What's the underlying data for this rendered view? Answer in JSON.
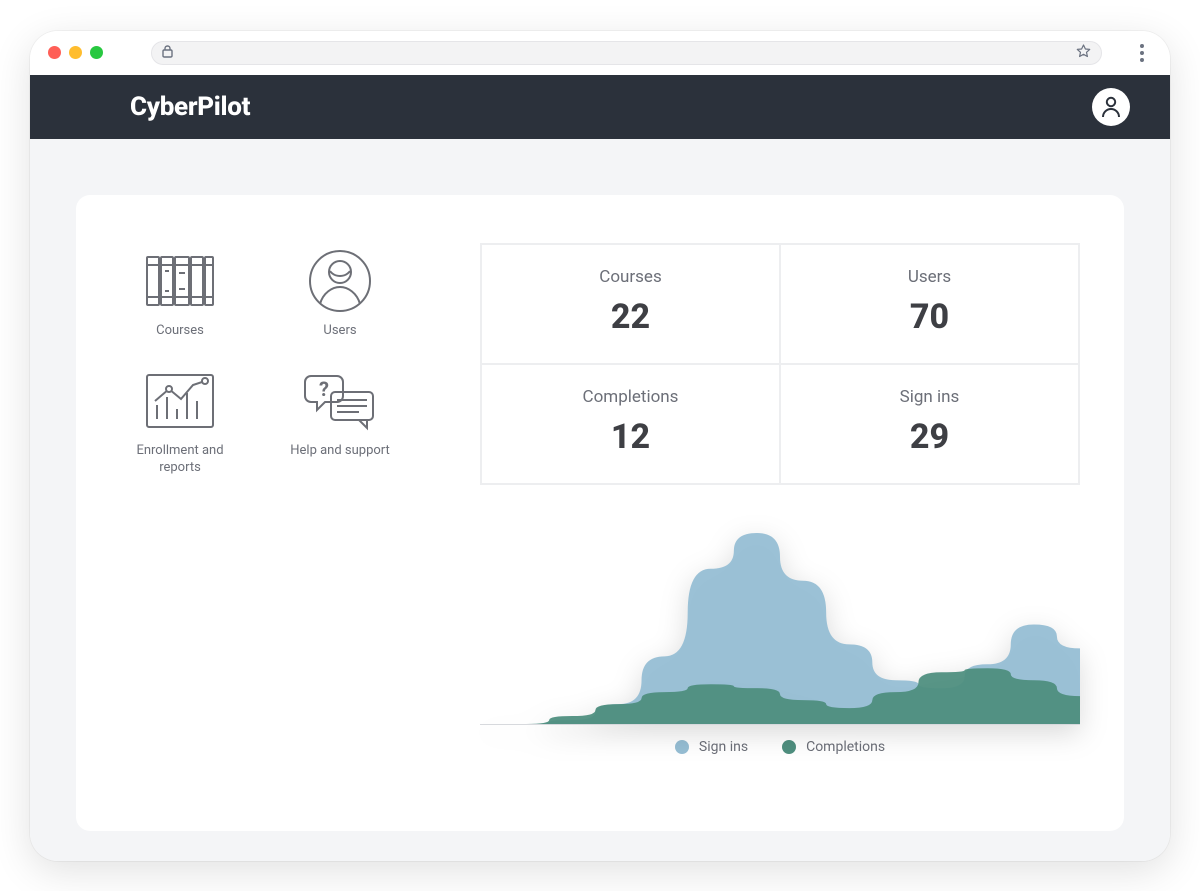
{
  "brand": "CyberPilot",
  "nav": {
    "items": [
      {
        "label": "Courses",
        "icon": "books-icon"
      },
      {
        "label": "Users",
        "icon": "user-circle-icon"
      },
      {
        "label": "Enrollment and reports",
        "icon": "reports-chart-icon"
      },
      {
        "label": "Help and support",
        "icon": "help-chat-icon"
      }
    ]
  },
  "stats": {
    "cells": [
      {
        "label": "Courses",
        "value": "22"
      },
      {
        "label": "Users",
        "value": "70"
      },
      {
        "label": "Completions",
        "value": "12"
      },
      {
        "label": "Sign ins",
        "value": "29"
      }
    ]
  },
  "chart_legend": {
    "items": [
      {
        "label": "Sign ins",
        "color": "#96bed4"
      },
      {
        "label": "Completions",
        "color": "#4f8f7f"
      }
    ]
  },
  "chart_data": {
    "type": "area",
    "x": [
      0,
      1,
      2,
      3,
      4,
      5,
      6,
      7,
      8,
      9,
      10,
      11,
      12,
      13
    ],
    "series": [
      {
        "name": "Sign ins",
        "color": "#96bed4",
        "values": [
          0,
          0,
          2,
          10,
          34,
          78,
          96,
          72,
          40,
          22,
          18,
          30,
          50,
          38
        ]
      },
      {
        "name": "Completions",
        "color": "#4f8f7f",
        "values": [
          0,
          0,
          4,
          10,
          16,
          20,
          18,
          12,
          8,
          16,
          26,
          28,
          22,
          14
        ]
      }
    ],
    "ylim": [
      0,
      100
    ],
    "xlabel": "",
    "ylabel": "",
    "title": ""
  },
  "colors": {
    "headerBg": "#2b313b",
    "pageBg": "#f4f5f7",
    "textMuted": "#6c6f78",
    "statValue": "#3e3f44",
    "chartBlue": "#96bed4",
    "chartGreen": "#4f8f7f"
  }
}
